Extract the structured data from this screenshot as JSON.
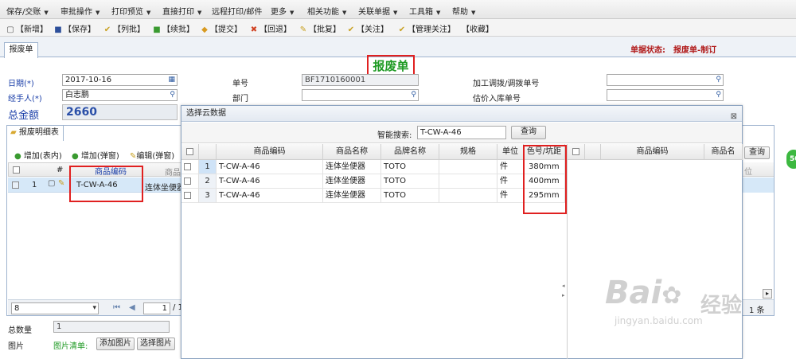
{
  "menubar": {
    "items": [
      "保存/交账",
      "审批操作",
      "打印预览",
      "直接打印",
      "远程打印/邮件",
      "更多",
      "相关功能",
      "关联单据",
      "工具箱",
      "帮助"
    ]
  },
  "toolbar": {
    "items": [
      "【新增】",
      "【保存】",
      "【列批】",
      "【续批】",
      "【提交】",
      "【回退】",
      "【批复】",
      "【关注】",
      "【管理关注】",
      "【收藏】"
    ]
  },
  "tabs": {
    "active": "报废单"
  },
  "status": {
    "label": "单据状态:",
    "value": "报废单-制订"
  },
  "form": {
    "title": "报废单",
    "date_label": "日期",
    "req_mark": "(*)",
    "date_value": "2017-10-16",
    "handler_label": "经手人",
    "handler_value": "白志鹏",
    "total_label": "总金额",
    "total_value": "2660",
    "docno_label": "单号",
    "docno_value": "BF1710160001",
    "dept_label": "部门",
    "dept_value": "",
    "proc_label": "加工调拨/调拨单号",
    "proc_value": "",
    "est_label": "估价入库单号",
    "est_value": ""
  },
  "detail": {
    "tab": "报废明细表",
    "btn_add_inline": "增加(表内)",
    "btn_add_popup": "增加(弹窗)",
    "btn_edit_popup": "编辑(弹窗)",
    "col_hash": "#",
    "col_code": "商品编码",
    "col_name_partial": "商品",
    "row1_num": "1",
    "row1_code": "T-CW-A-46",
    "row1_name_partial": "连体坐便器",
    "pager_size": "8",
    "pager_page": "1",
    "pager_of": "/ 1",
    "right_btn": "查询",
    "right_hdr_partial": "位",
    "right_count": "1 条"
  },
  "bottom": {
    "qty_label": "总数量",
    "qty_value": "1",
    "img_label": "图片",
    "img_list_label": "图片清单:",
    "btn_add_img": "添加图片",
    "btn_select_img": "选择图片"
  },
  "dialog": {
    "title": "选择云数据",
    "close": "⊠",
    "search_label": "智能搜索:",
    "search_value": "T-CW-A-46",
    "search_btn": "查询",
    "columns": [
      "商品编码",
      "商品名称",
      "品牌名称",
      "规格",
      "单位",
      "色号/坑距"
    ],
    "rows": [
      {
        "num": "1",
        "code": "T-CW-A-46",
        "name": "连体坐便器",
        "brand": "TOTO",
        "spec": "",
        "unit": "件",
        "color": "380mm"
      },
      {
        "num": "2",
        "code": "T-CW-A-46",
        "name": "连体坐便器",
        "brand": "TOTO",
        "spec": "",
        "unit": "件",
        "color": "400mm"
      },
      {
        "num": "3",
        "code": "T-CW-A-46",
        "name": "连体坐便器",
        "brand": "TOTO",
        "spec": "",
        "unit": "件",
        "color": "295mm"
      }
    ],
    "right_columns": [
      "商品编码",
      "商品名"
    ]
  },
  "watermark": {
    "main": "Bai",
    "mid": "经验",
    "url": "jingyan.baidu.com"
  },
  "colors": {
    "accent_red": "#e02020",
    "title_green": "#1e9a23",
    "link_blue": "#1a3ea8"
  }
}
